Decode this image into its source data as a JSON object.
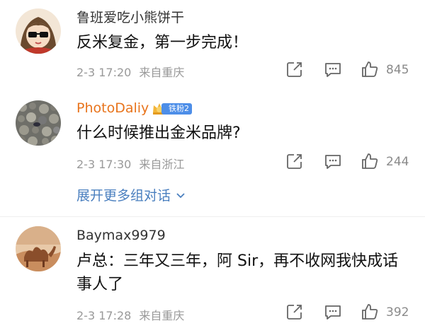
{
  "comments": [
    {
      "username": "鲁班爱吃小熊饼干",
      "content": "反米复金，第一步完成！",
      "time": "2-3 17:20",
      "location": "来自重庆",
      "likes": "845",
      "avatar": "cartoon-girl-avatar"
    },
    {
      "username": "PhotoDaliy",
      "badge": "铁粉2",
      "content": "什么时候推出金米品牌?",
      "time": "2-3 17:30",
      "location": "来自浙江",
      "likes": "244",
      "avatar": "pebbles-avatar"
    },
    {
      "username": "Baymax9979",
      "content": "卢总：三年又三年，阿 Sir，再不收网我快成话事人了",
      "time": "2-3 17:28",
      "location": "来自重庆",
      "likes": "392",
      "avatar": "camel-desert-avatar"
    }
  ],
  "expand_replies": "展开更多组对话",
  "colors": {
    "username": "#333333",
    "vip_username": "#e8741c",
    "link": "#4a7fbf",
    "meta": "#999999",
    "badge": "#4d8ee8"
  }
}
